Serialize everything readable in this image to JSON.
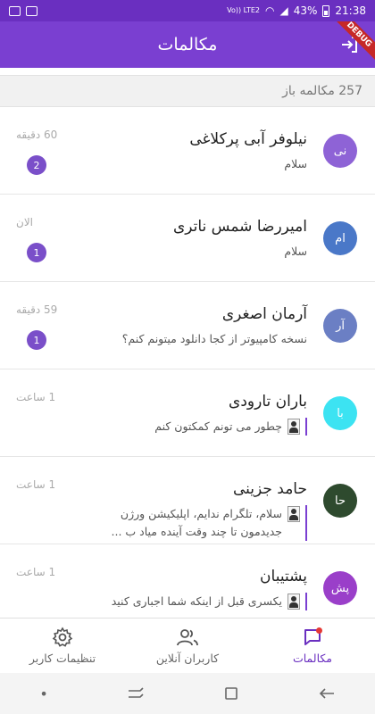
{
  "status_bar": {
    "time": "21:38",
    "battery": "43%",
    "network": "Vo)) LTE2"
  },
  "app_bar": {
    "title": "مکالمات",
    "debug_label": "DEBUG",
    "logout_icon": "logout-icon"
  },
  "summary": {
    "open_conversations": "257 مکالمه باز"
  },
  "conversations": [
    {
      "avatar": "نی",
      "avatar_color": "#8e63d6",
      "name": "نیلوفر آبی پرکلاغی",
      "preview": "سلام",
      "time": "60 دقیقه",
      "unread": "2",
      "has_reply_thumb": false
    },
    {
      "avatar": "ام",
      "avatar_color": "#4a78c8",
      "name": "امیررضا شمس ناتری",
      "preview": "سلام",
      "time": "الان",
      "unread": "1",
      "has_reply_thumb": false
    },
    {
      "avatar": "آر",
      "avatar_color": "#6b7fc4",
      "name": "آرمان اصغری",
      "preview": "نسخه کامپیوتر از کجا دانلود میتونم کنم؟",
      "time": "59 دقیقه",
      "unread": "1",
      "has_reply_thumb": false
    },
    {
      "avatar": "با",
      "avatar_color": "#3ce3f2",
      "name": "باران تارودی",
      "preview": "چطور می تونم کمکتون کنم",
      "time": "1 ساعت",
      "unread": "",
      "has_reply_thumb": true
    },
    {
      "avatar": "حا",
      "avatar_color": "#2e4a2e",
      "name": "حامد جزینی",
      "preview": "سلام، تلگرام ندایم، اپلیکیشن ورژن جدیدمون تا چند وقت آینده میاد ب ...",
      "time": "1 ساعت",
      "unread": "",
      "has_reply_thumb": true
    },
    {
      "avatar": "پش",
      "avatar_color": "#9a3fc9",
      "name": "پشتیبان",
      "preview": "یکسری قبل از اینکه شما اجباری کنید",
      "time": "1 ساعت",
      "unread": "",
      "has_reply_thumb": true
    }
  ],
  "bottom_nav": {
    "chats": "مکالمات",
    "online_users": "کاربران آنلاین",
    "user_settings": "تنظیمات کاربر"
  }
}
